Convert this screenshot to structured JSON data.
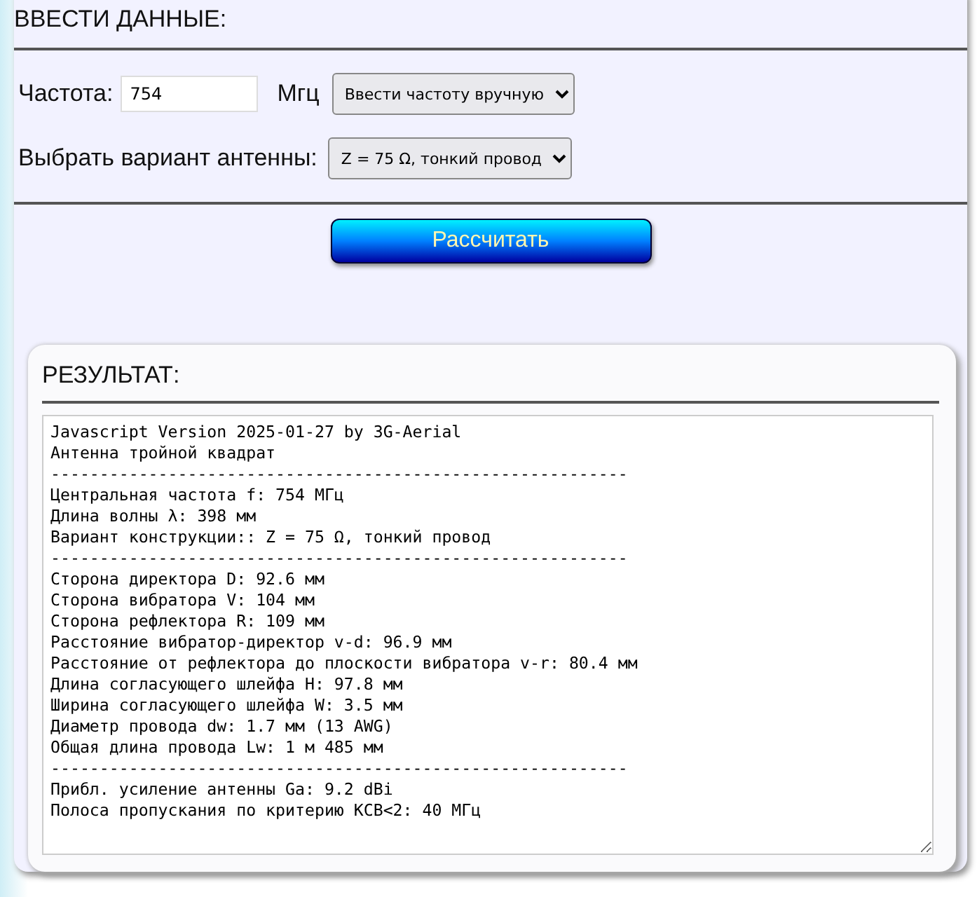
{
  "input_section": {
    "title": "ВВЕСТИ ДАННЫЕ:",
    "frequency_label": "Частота:",
    "frequency": {
      "value": "754"
    },
    "unit": "Мгц",
    "frequency_mode": {
      "value": "Ввести частоту вручную"
    },
    "antenna_label": "Выбрать вариант антенны:",
    "antenna_variant": {
      "value": "Z = 75 Ω, тонкий провод"
    },
    "calculate_button": "Рассчитать"
  },
  "result_section": {
    "title": "РЕЗУЛЬТАТ:",
    "output_lines": [
      "Javascript Version 2025-01-27 by 3G-Aerial",
      "Антенна тройной квадрат",
      "-----------------------------------------------------------",
      "Центральная частота f: 754 МГц",
      "Длина волны λ: 398 мм",
      "Вариант конструкции:: Z = 75 Ω, тонкий провод",
      "-----------------------------------------------------------",
      "Сторона директора D: 92.6 мм",
      "Сторона вибратора V: 104 мм",
      "Сторона рефлектора R: 109 мм",
      "Расстояние вибратор-директор v-d: 96.9 мм",
      "Расстояние от рефлектора до плоскости вибратора v-r: 80.4 мм",
      "Длина согласующего шлейфа H: 97.8 мм",
      "Ширина согласующего шлейфа W: 3.5 мм",
      "Диаметр провода dw: 1.7 мм (13 AWG)",
      "Общая длина провода Lw: 1 м 485 мм",
      "-----------------------------------------------------------",
      "Прибл. усиление антенны Ga: 9.2 dBi",
      "Полоса пропускания по критерию КСВ<2: 40 МГц"
    ]
  }
}
